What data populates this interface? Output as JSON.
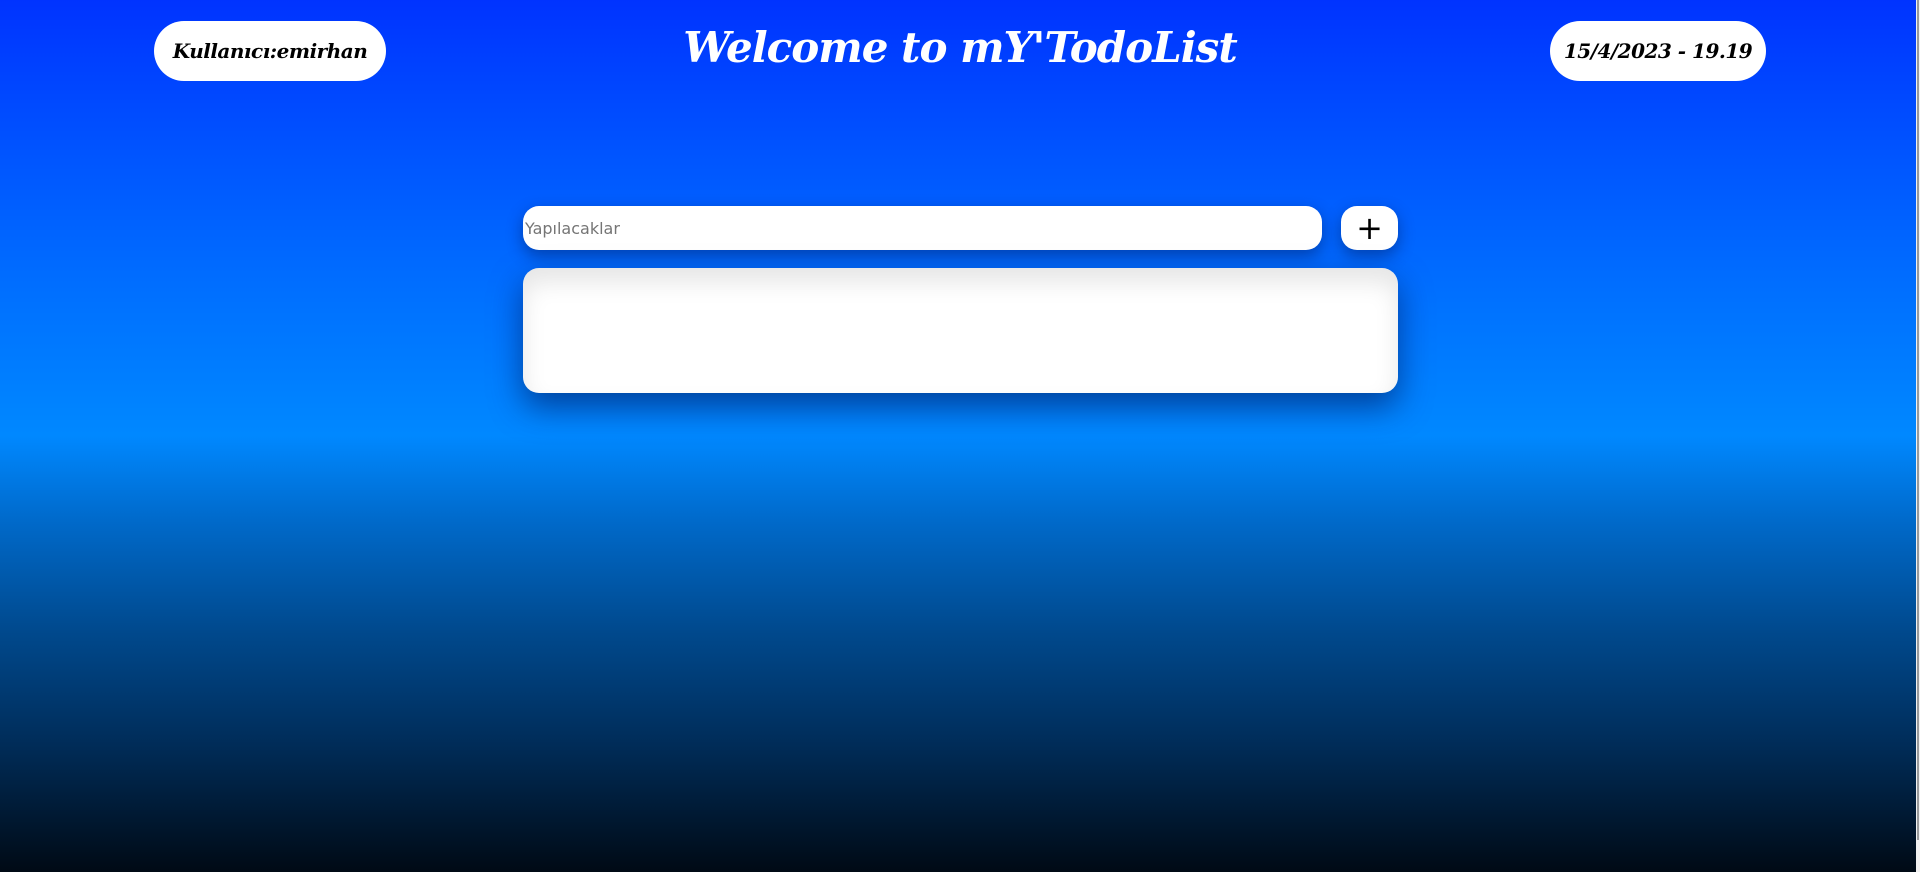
{
  "header": {
    "user_label": "Kullanıcı:emirhan",
    "title": "Welcome to mY'TodoList",
    "datetime": "15/4/2023 - 19.19"
  },
  "todo": {
    "input_placeholder": "Yapılacaklar",
    "input_value": "",
    "add_button_label": "+",
    "items": []
  },
  "colors": {
    "gradient_top": "#0033ff",
    "gradient_mid": "#0088ff",
    "gradient_bottom": "#000a15",
    "pill_background": "#ffffff"
  },
  "icons": {
    "add": "plus-icon"
  }
}
